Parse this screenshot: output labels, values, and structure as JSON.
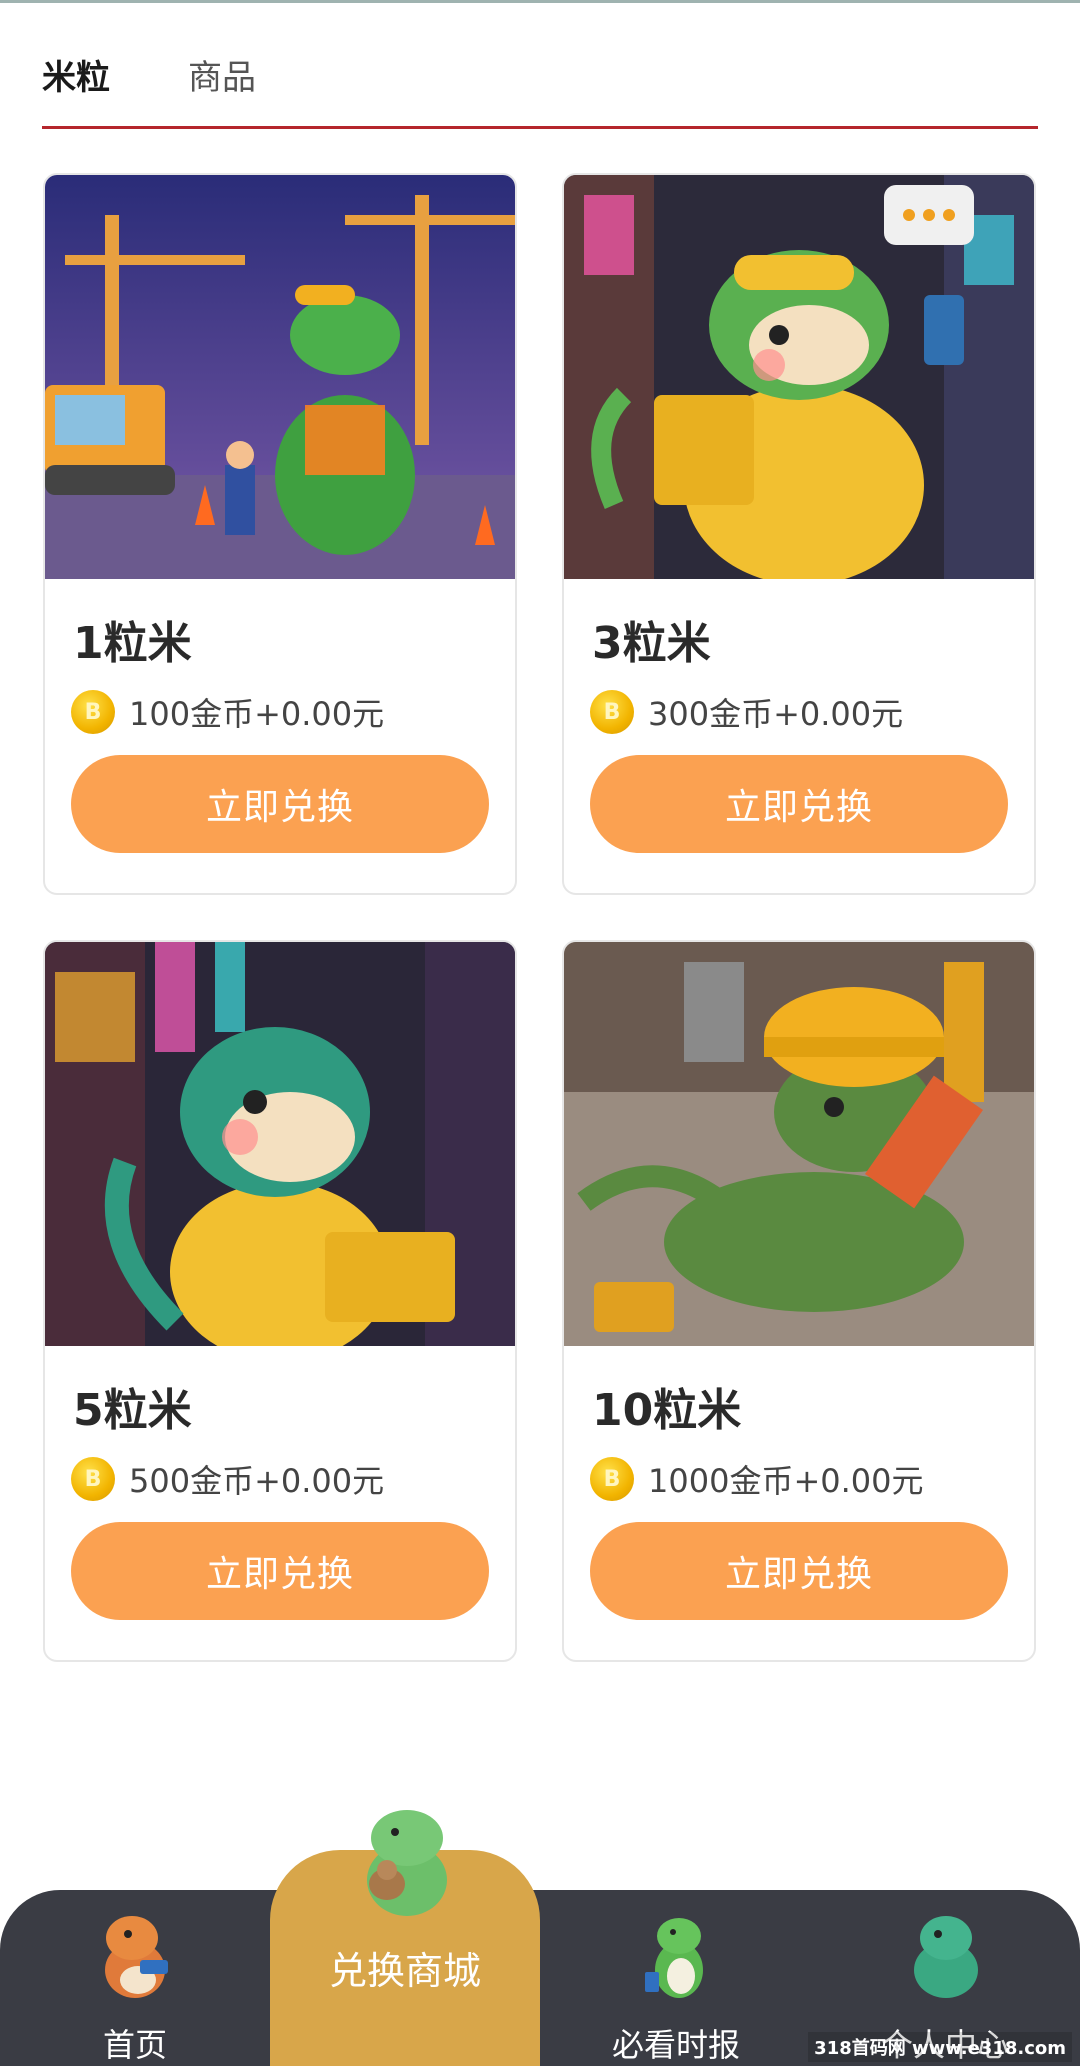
{
  "tabs": [
    {
      "label": "米粒",
      "active": true
    },
    {
      "label": "商品",
      "active": false
    }
  ],
  "colors": {
    "accent": "#b5262c",
    "button": "#fba151",
    "nav_bg": "#3a3c44",
    "nav_active": "#d8a64a"
  },
  "products": [
    {
      "title": "1粒米",
      "price": "100金币+0.00元",
      "button": "立即兑换",
      "image_icon": "construction-dino-image"
    },
    {
      "title": "3粒米",
      "price": "300金币+0.00元",
      "button": "立即兑换",
      "image_icon": "delivery-dino-phone-image"
    },
    {
      "title": "5粒米",
      "price": "500金币+0.00元",
      "button": "立即兑换",
      "image_icon": "delivery-dino-box-image"
    },
    {
      "title": "10粒米",
      "price": "1000金币+0.00元",
      "button": "立即兑换",
      "image_icon": "repair-dino-wrench-image"
    }
  ],
  "coin_symbol": "B",
  "bottom_nav": [
    {
      "label": "首页",
      "icon": "home-dino-icon"
    },
    {
      "label": "兑换商城",
      "icon": "shop-dino-icon",
      "active": true
    },
    {
      "label": "必看时报",
      "icon": "news-dino-icon"
    },
    {
      "label": "个人中心",
      "icon": "profile-dino-icon"
    }
  ],
  "watermark": "318首码网 www.e318.com"
}
